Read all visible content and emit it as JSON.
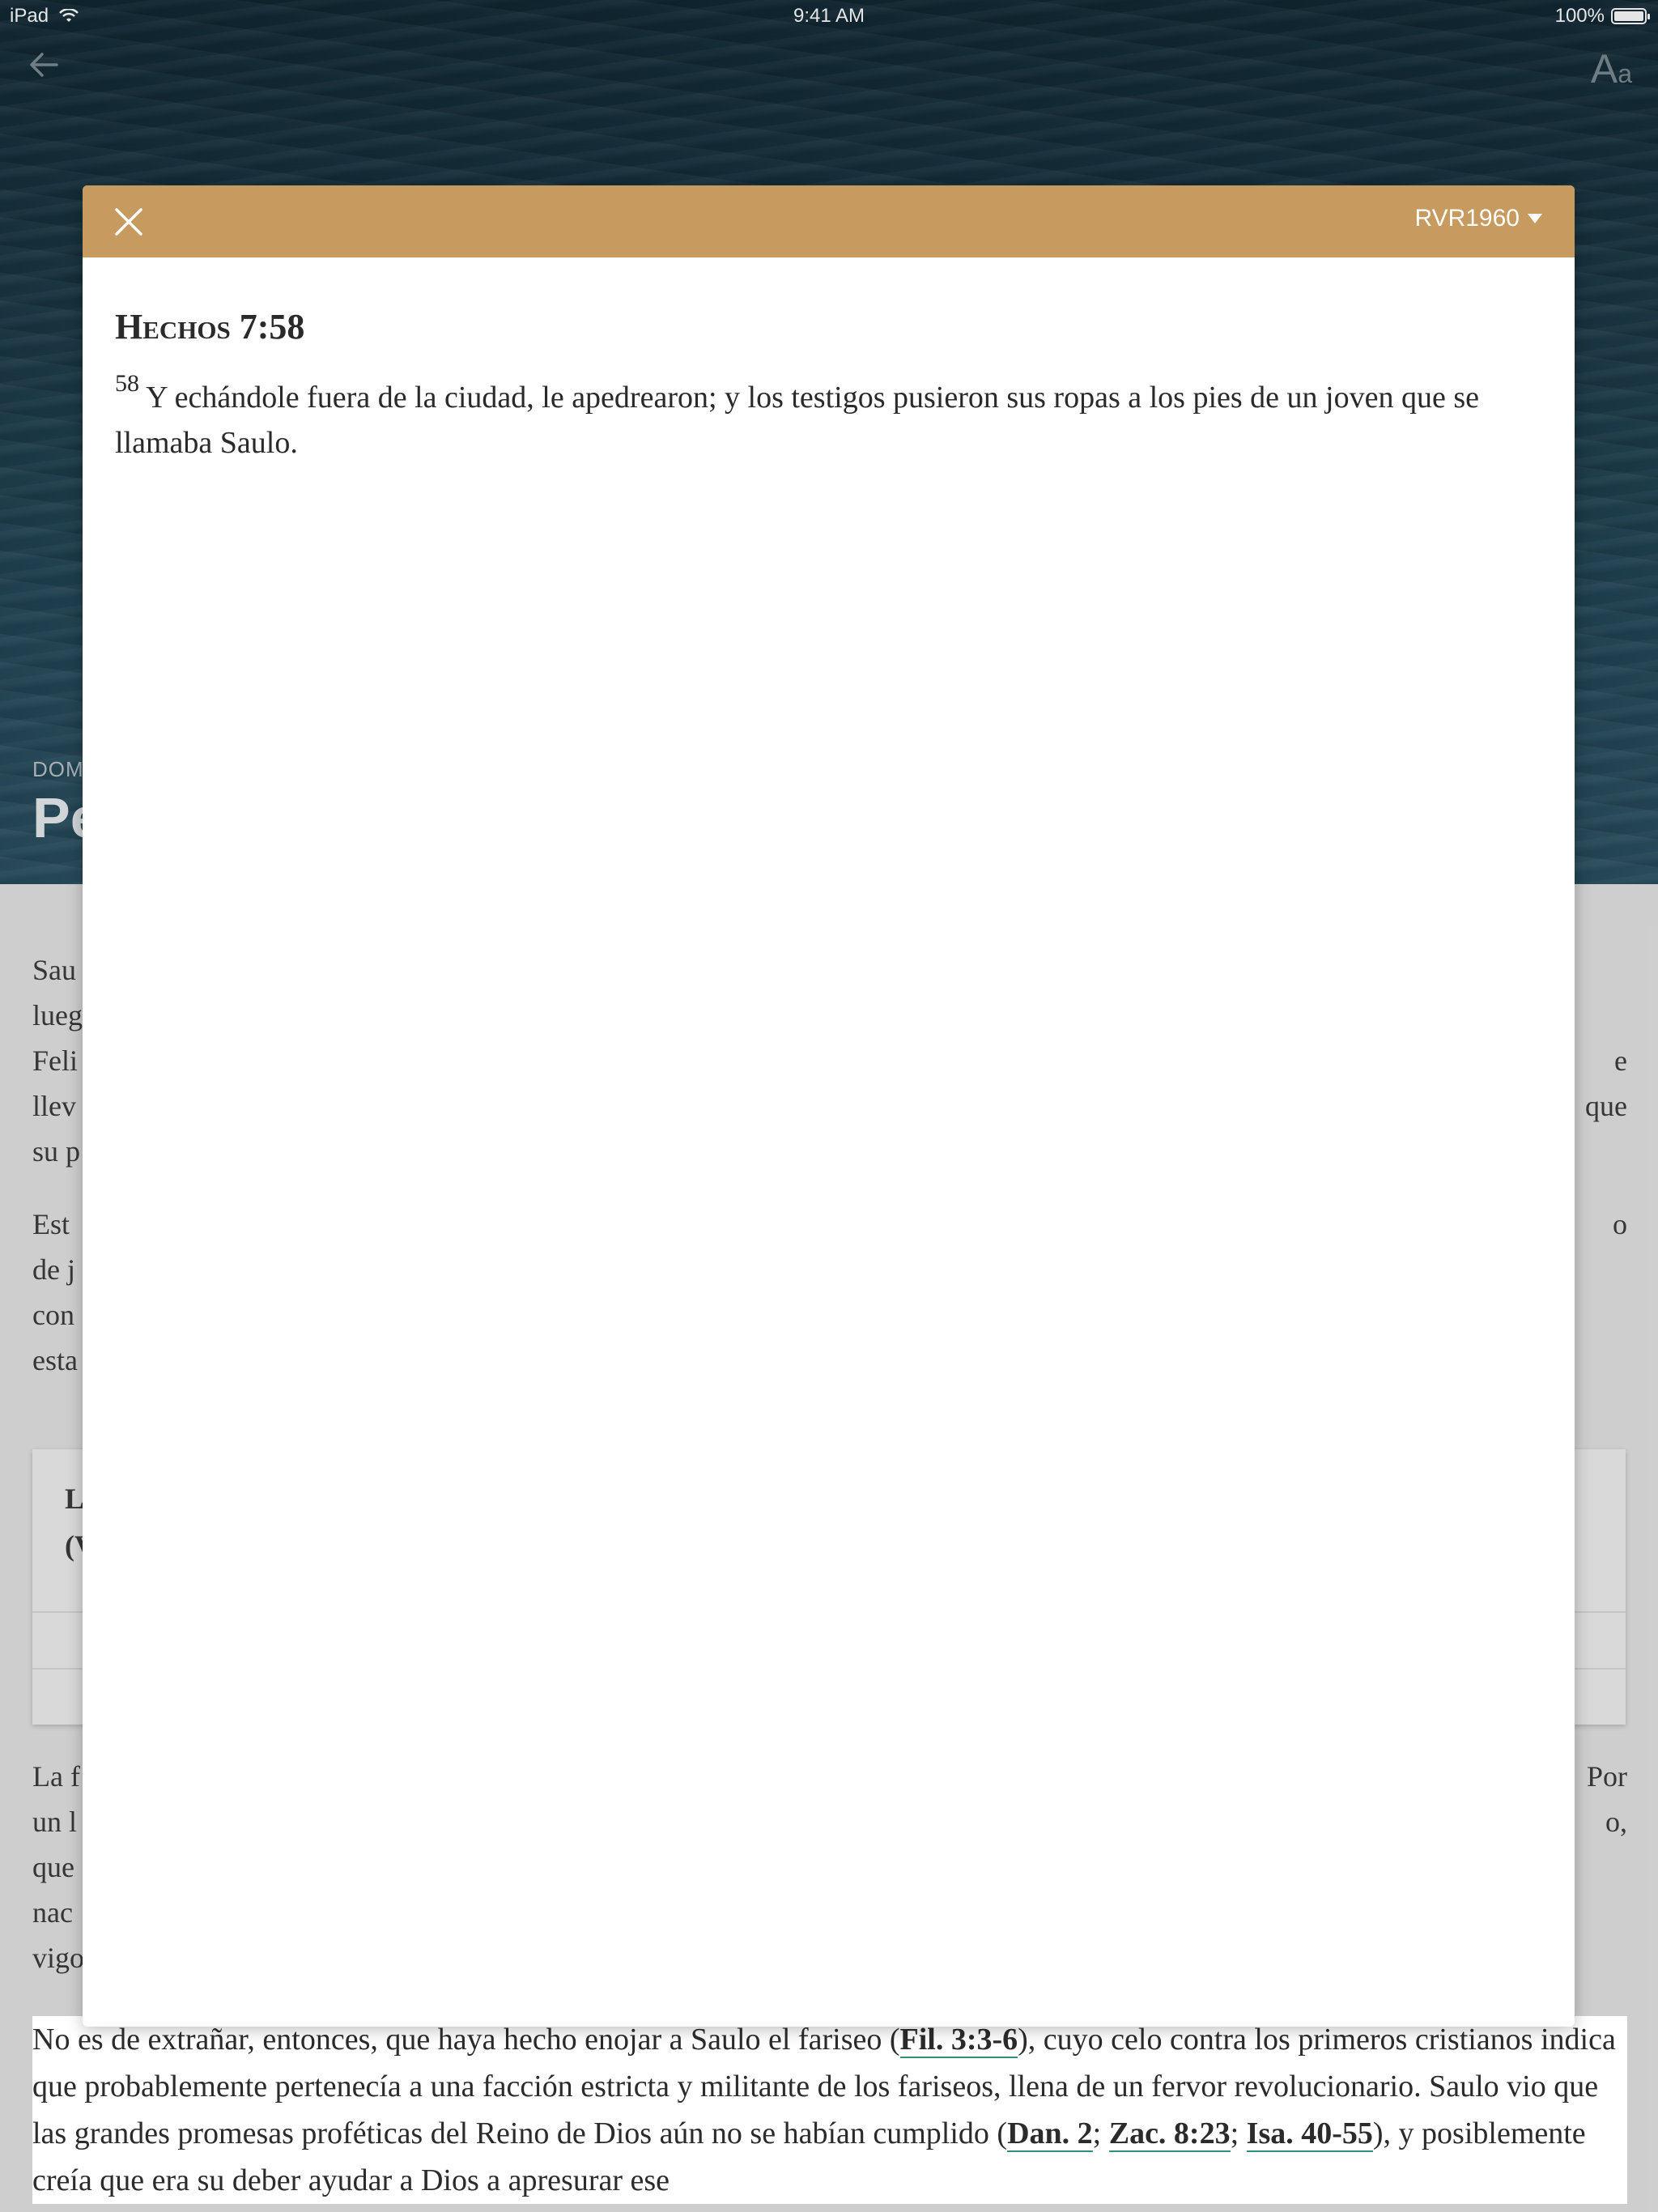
{
  "status_bar": {
    "device": "iPad",
    "time": "9:41 AM",
    "battery": "100%"
  },
  "background": {
    "kicker": "DOM",
    "title": "Pe",
    "paragraphs": [
      [
        "Sau",
        "lueg",
        "Feli",
        "llev",
        "su p"
      ],
      [
        "Est",
        "de j",
        "con",
        "esta"
      ]
    ],
    "right_fragments": [
      "e",
      "que",
      "o"
    ],
    "card_lines": [
      "L",
      "(V"
    ],
    "para3_left": [
      "La f",
      "un l",
      "que",
      "nac",
      "vigo"
    ],
    "para3_right": [
      "Por",
      "o,"
    ],
    "bottom": {
      "t1": "No es de extrañar, entonces, que haya hecho enojar a Saulo el fariseo (",
      "r1": "Fil. 3:3-6",
      "t2": "), cuyo celo contra los primeros cristianos indica que probablemente pertenecía a una facción estricta y militante de los fariseos, llena de un fervor revolucionario. Saulo vio que las grandes promesas proféticas del Reino de Dios aún no se habían cumplido (",
      "r2": "Dan. 2",
      "t3": "; ",
      "r3": "Zac. 8:23",
      "t4": "; ",
      "r4": "Isa. 40-55",
      "t5": "), y posiblemente creía que era su deber ayudar a Dios a apresurar ese"
    }
  },
  "modal": {
    "version": "RVR1960",
    "reference": "Hechos 7:58",
    "verse_number": "58",
    "verse_text": "Y echándole fuera de la ciudad, le apedrearon; y los testigos pusieron sus ropas a los pies de un joven que se llamaba Saulo."
  },
  "icons": {
    "back": "arrow-left-icon",
    "font": "font-size-icon",
    "close": "close-icon",
    "wifi": "wifi-icon",
    "caret": "caret-down-icon"
  },
  "colors": {
    "modal_header": "#c79a5f",
    "reference_underline": "#2f8f7b"
  }
}
